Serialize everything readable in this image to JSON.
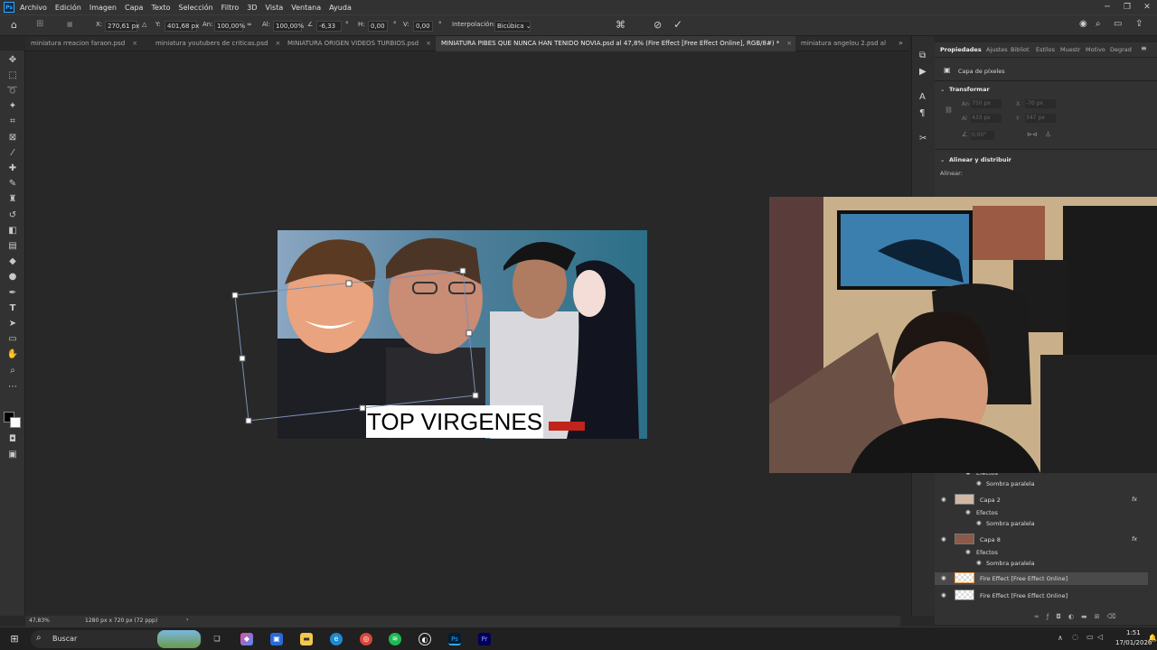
{
  "menu": {
    "logo": "Ps",
    "items": [
      "Archivo",
      "Edición",
      "Imagen",
      "Capa",
      "Texto",
      "Selección",
      "Filtro",
      "3D",
      "Vista",
      "Ventana",
      "Ayuda"
    ]
  },
  "options": {
    "x_label": "X:",
    "x_value": "270,61 px",
    "y_label": "Y:",
    "y_value": "401,68 px",
    "w_label": "An:",
    "w_value": "100,00%",
    "link": "∞",
    "h_label": "Al:",
    "h_value": "100,00%",
    "angle_value": "-6,33",
    "deg": "°",
    "hskew_label": "H:",
    "hskew_value": "0,00",
    "vskew_label": "V:",
    "vskew_value": "0,00",
    "interp_label": "Interpolación:",
    "interp_value": "Bicúbica"
  },
  "tabs": [
    {
      "label": "miniatura rreacion faraon.psd",
      "close": "×"
    },
    {
      "label": "miniatura youtubers de criticas.psd",
      "close": "×"
    },
    {
      "label": "MINIATURA ORIGEN VIDEOS TURBIOS.psd",
      "close": "×"
    },
    {
      "label": "MINIATURA PIBES QUE NUNCA HAN TENIDO NOVIA.psd al 47,8% (Fire Effect [Free Effect Online], RGB/8#) *",
      "close": "×"
    },
    {
      "label": "miniatura angelou 2.psd al",
      "close": ""
    }
  ],
  "canvas": {
    "thumbnail_text": "TOP VIRGENES"
  },
  "status": {
    "zoom": "47,83%",
    "doc_size": "1280 px x 720 px (72 ppp)"
  },
  "properties": {
    "tabs": [
      "Propiedades",
      "Ajustes",
      "Bibliot",
      "Estilos",
      "Muestr",
      "Motivo",
      "Degrad"
    ],
    "layer_type": "Capa de píxeles",
    "transform_title": "Transformar",
    "t_w_label": "An",
    "t_w_value": "750 px",
    "t_x_label": "X",
    "t_x_value": "-70 px",
    "t_h_label": "Al",
    "t_h_value": "433 px",
    "t_y_label": "Y",
    "t_y_value": "347 px",
    "t_angle_value": "0,00°",
    "align_title": "Alinear y distribuir",
    "align_label": "Alinear:"
  },
  "layers": {
    "rows": [
      {
        "kind": "sub",
        "label": "Efectos"
      },
      {
        "kind": "effect",
        "label": "Sombra paralela"
      },
      {
        "kind": "layer",
        "label": "Capa 2",
        "fx": "fx"
      },
      {
        "kind": "sub",
        "label": "Efectos"
      },
      {
        "kind": "effect",
        "label": "Sombra paralela"
      },
      {
        "kind": "layer",
        "label": "Capa 8",
        "fx": "fx"
      },
      {
        "kind": "sub",
        "label": "Efectos"
      },
      {
        "kind": "effect",
        "label": "Sombra paralela"
      },
      {
        "kind": "layer",
        "label": "Fire Effect [Free Effect Online]",
        "fx": "",
        "selected": true
      },
      {
        "kind": "layer",
        "label": "Fire Effect [Free Effect Online]",
        "fx": ""
      }
    ]
  },
  "taskbar": {
    "search_placeholder": "Buscar",
    "time": "1:51",
    "date": "17/01/2026"
  },
  "colors": {
    "accent": "#31a8ff",
    "bg": "#282828",
    "panel": "#323232"
  }
}
